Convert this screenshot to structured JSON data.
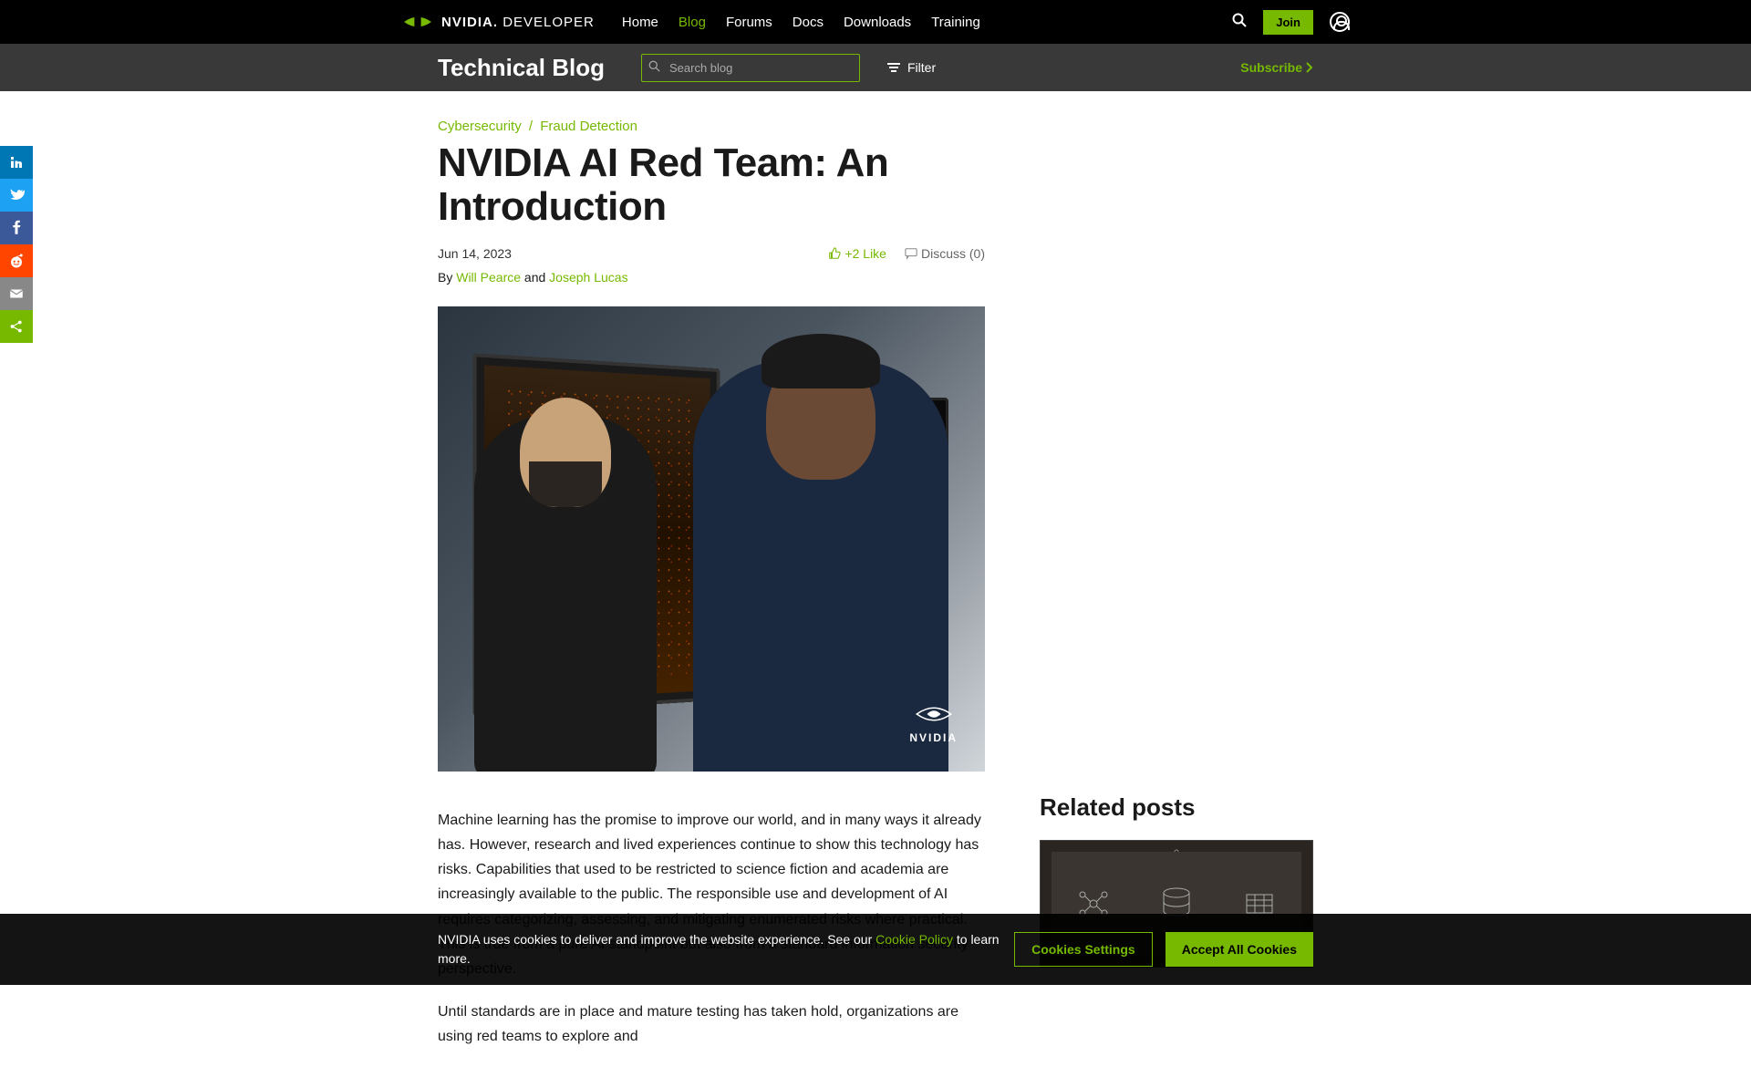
{
  "header": {
    "logo_main": "NVIDIA",
    "logo_sub": "DEVELOPER",
    "nav": [
      {
        "label": "Home",
        "active": false
      },
      {
        "label": "Blog",
        "active": true
      },
      {
        "label": "Forums",
        "active": false
      },
      {
        "label": "Docs",
        "active": false
      },
      {
        "label": "Downloads",
        "active": false
      },
      {
        "label": "Training",
        "active": false
      }
    ],
    "join_label": "Join"
  },
  "subheader": {
    "title": "Technical Blog",
    "search_placeholder": "Search blog",
    "filter_label": "Filter",
    "subscribe_label": "Subscribe"
  },
  "article": {
    "category1": "Cybersecurity",
    "category_sep": "/",
    "category2": "Fraud Detection",
    "title": "NVIDIA AI Red Team: An Introduction",
    "date": "Jun 14, 2023",
    "like_text": "+2 Like",
    "discuss_text": "Discuss (0)",
    "by_prefix": "By ",
    "author1": "Will Pearce",
    "author_and": " and ",
    "author2": "Joseph Lucas",
    "hero_logo_text": "NVIDIA",
    "p1": "Machine learning has the promise to improve our world, and in many ways it already has. However, research and lived experiences continue to show this technology has risks. Capabilities that used to be restricted to science fiction and academia are increasingly available to the public. The responsible use and development of AI requires categorizing, assessing, and mitigating enumerated risks where practical. This is true from a pure AI standpoint but also from a standard information security perspective.",
    "p2": "Until standards are in place and mature testing has taken hold, organizations are using red teams to explore and"
  },
  "sidebar": {
    "related_title": "Related posts"
  },
  "cookie": {
    "text_pre": "NVIDIA uses cookies to deliver and improve the website experience. See our ",
    "link": "Cookie Policy",
    "text_post": " to learn more.",
    "settings_label": "Cookies Settings",
    "accept_label": "Accept All Cookies"
  },
  "colors": {
    "nvidia_green": "#76b900"
  }
}
